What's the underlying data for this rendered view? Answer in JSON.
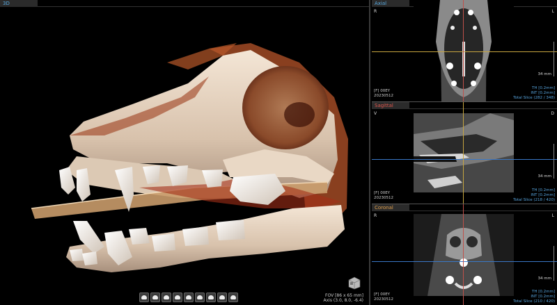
{
  "viewports": {
    "3d": {
      "label": "3D"
    },
    "axial": {
      "label": "Axial",
      "orient_left": "R",
      "orient_right": "L",
      "info_left": [
        "[F] 00EY",
        "20230512"
      ],
      "info_right": [
        "TH [0.2mm]",
        "INT [0.2mm]",
        "Total Slice (282 / 348)"
      ],
      "scale": "34 mm"
    },
    "sagittal": {
      "label": "Sagittal",
      "orient_left": "V",
      "orient_right": "D",
      "info_left": [
        "[F] 00EY",
        "20230512"
      ],
      "info_right": [
        "TH [0.2mm]",
        "INT [0.2mm]",
        "Total Slice (218 / 420)"
      ],
      "scale": "34 mm"
    },
    "coronal": {
      "label": "Coronal",
      "orient_left": "R",
      "orient_right": "L",
      "info_left": [
        "[F] 00EY",
        "20230512"
      ],
      "info_right": [
        "TH [0.2mm]",
        "INT [0.2mm]",
        "Total Slice (210 / 420)"
      ],
      "scale": "34 mm"
    }
  },
  "fov": [
    "FOV [86 x 65 mm]",
    "Axis (3.0, 8.0, -6.4)"
  ],
  "toolbar": {
    "tools": [
      "view-preset-1-icon",
      "view-preset-2-icon",
      "view-preset-3-icon",
      "view-preset-4-icon",
      "view-preset-5-icon",
      "view-preset-6-icon",
      "view-preset-7-icon",
      "view-preset-8-icon",
      "view-preset-9-icon"
    ]
  },
  "colors": {
    "tab_axial": "#57a9e0",
    "tab_sagittal": "#e0574d",
    "tab_coronal": "#e0a04d",
    "crosshair_yellow": "#c8a640",
    "crosshair_blue": "#3a78c8",
    "info_blue": "#58a6e0"
  }
}
